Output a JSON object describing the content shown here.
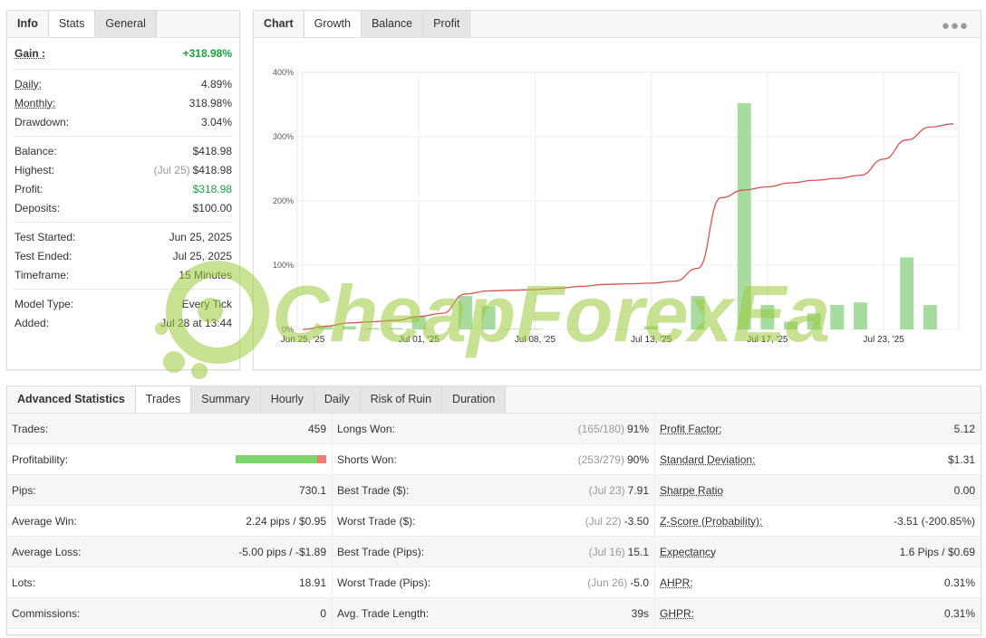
{
  "stats_tabs": [
    "Info",
    "Stats",
    "General"
  ],
  "stats_groups": [
    [
      {
        "label": "Gain :",
        "value": "+318.98%",
        "style": "gain"
      }
    ],
    [
      {
        "label": "Daily:",
        "value": "4.89%",
        "u": true
      },
      {
        "label": "Monthly:",
        "value": "318.98%",
        "u": true
      },
      {
        "label": "Drawdown:",
        "value": "3.04%"
      }
    ],
    [
      {
        "label": "Balance:",
        "value": "$418.98"
      },
      {
        "label": "Highest:",
        "muted": "(Jul 25)",
        "value": "$418.98"
      },
      {
        "label": "Profit:",
        "value": "$318.98",
        "style": "green"
      },
      {
        "label": "Deposits:",
        "value": "$100.00"
      }
    ],
    [
      {
        "label": "Test Started:",
        "value": "Jun 25, 2025"
      },
      {
        "label": "Test Ended:",
        "value": "Jul 25, 2025"
      },
      {
        "label": "Timeframe:",
        "value": "15 Minutes"
      }
    ],
    [
      {
        "label": "Model Type:",
        "value": "Every Tick"
      },
      {
        "label": "Added:",
        "value": "Jul 28 at 13:44"
      }
    ]
  ],
  "chart_tabs": [
    "Chart",
    "Growth",
    "Balance",
    "Profit"
  ],
  "chart_menu_icon": "more-dots-icon",
  "chart_data": {
    "type": "line",
    "title": "",
    "ylim": [
      0,
      400
    ],
    "y_ticks": [
      0,
      100,
      200,
      300,
      400
    ],
    "y_tick_labels": [
      "0%",
      "100%",
      "200%",
      "300%",
      "400%"
    ],
    "x_tick_labels": [
      "Jun 25, '25",
      "Jul 01, '25",
      "Jul 08, '25",
      "Jul 13, '25",
      "Jul 17, '25",
      "Jul 23, '25"
    ],
    "x_tick_positions": [
      0,
      5,
      10,
      15,
      20,
      25
    ],
    "grid": true,
    "line_color": "#d9534f",
    "bar_color": "#a8dba0",
    "growth_line": [
      [
        0,
        0
      ],
      [
        1,
        5
      ],
      [
        2,
        10
      ],
      [
        3,
        12
      ],
      [
        4,
        14
      ],
      [
        5,
        20
      ],
      [
        6,
        25
      ],
      [
        7,
        55
      ],
      [
        8,
        60
      ],
      [
        9,
        61
      ],
      [
        10,
        62
      ],
      [
        11,
        64
      ],
      [
        12,
        67
      ],
      [
        13,
        70
      ],
      [
        14,
        71
      ],
      [
        15,
        72
      ],
      [
        16,
        75
      ],
      [
        17,
        95
      ],
      [
        18,
        205
      ],
      [
        19,
        217
      ],
      [
        20,
        222
      ],
      [
        21,
        228
      ],
      [
        22,
        232
      ],
      [
        23,
        235
      ],
      [
        24,
        240
      ],
      [
        25,
        265
      ],
      [
        26,
        295
      ],
      [
        27,
        315
      ],
      [
        28,
        320
      ]
    ],
    "daily_bars": [
      [
        1,
        5
      ],
      [
        2,
        5
      ],
      [
        3,
        2
      ],
      [
        4,
        2
      ],
      [
        5,
        20
      ],
      [
        7,
        52
      ],
      [
        8,
        36
      ],
      [
        9,
        1
      ],
      [
        10,
        1
      ],
      [
        15,
        5
      ],
      [
        17,
        52
      ],
      [
        19,
        352
      ],
      [
        20,
        38
      ],
      [
        21,
        12
      ],
      [
        22,
        25
      ],
      [
        23,
        38
      ],
      [
        24,
        42
      ],
      [
        26,
        112
      ],
      [
        27,
        38
      ]
    ]
  },
  "adv_tabs": [
    "Advanced Statistics",
    "Trades",
    "Summary",
    "Hourly",
    "Daily",
    "Risk of Ruin",
    "Duration"
  ],
  "adv_rows": [
    [
      {
        "label": "Trades:",
        "value": "459"
      },
      {
        "label": "Longs Won:",
        "muted": "(165/180)",
        "value": "91%"
      },
      {
        "label": "Profit Factor:",
        "value": "5.12",
        "u": true
      }
    ],
    [
      {
        "label": "Profitability:",
        "bar_win_pct": 90
      },
      {
        "label": "Shorts Won:",
        "muted": "(253/279)",
        "value": "90%"
      },
      {
        "label": "Standard Deviation:",
        "value": "$1.31",
        "u": true
      }
    ],
    [
      {
        "label": "Pips:",
        "value": "730.1"
      },
      {
        "label": "Best Trade ($):",
        "muted": "(Jul 23)",
        "value": "7.91"
      },
      {
        "label": "Sharpe Ratio",
        "value": "0.00",
        "u": true
      }
    ],
    [
      {
        "label": "Average Win:",
        "value": "2.24 pips / $0.95"
      },
      {
        "label": "Worst Trade ($):",
        "muted": "(Jul 22)",
        "value": "-3.50"
      },
      {
        "label": "Z-Score (Probability):",
        "value": "-3.51 (-200.85%)",
        "u": true
      }
    ],
    [
      {
        "label": "Average Loss:",
        "value": "-5.00 pips / -$1.89"
      },
      {
        "label": "Best Trade (Pips):",
        "muted": "(Jul 16)",
        "value": "15.1"
      },
      {
        "label": "Expectancy",
        "value": "1.6 Pips / $0.69",
        "u": true
      }
    ],
    [
      {
        "label": "Lots:",
        "value": "18.91"
      },
      {
        "label": "Worst Trade (Pips):",
        "muted": "(Jun 26)",
        "value": "-5.0"
      },
      {
        "label": "AHPR:",
        "value": "0.31%",
        "u": true
      }
    ],
    [
      {
        "label": "Commissions:",
        "value": "0"
      },
      {
        "label": "Avg. Trade Length:",
        "value": "39s"
      },
      {
        "label": "GHPR:",
        "value": "0.31%",
        "u": true
      }
    ]
  ],
  "watermark_text": "CheapForexEa"
}
